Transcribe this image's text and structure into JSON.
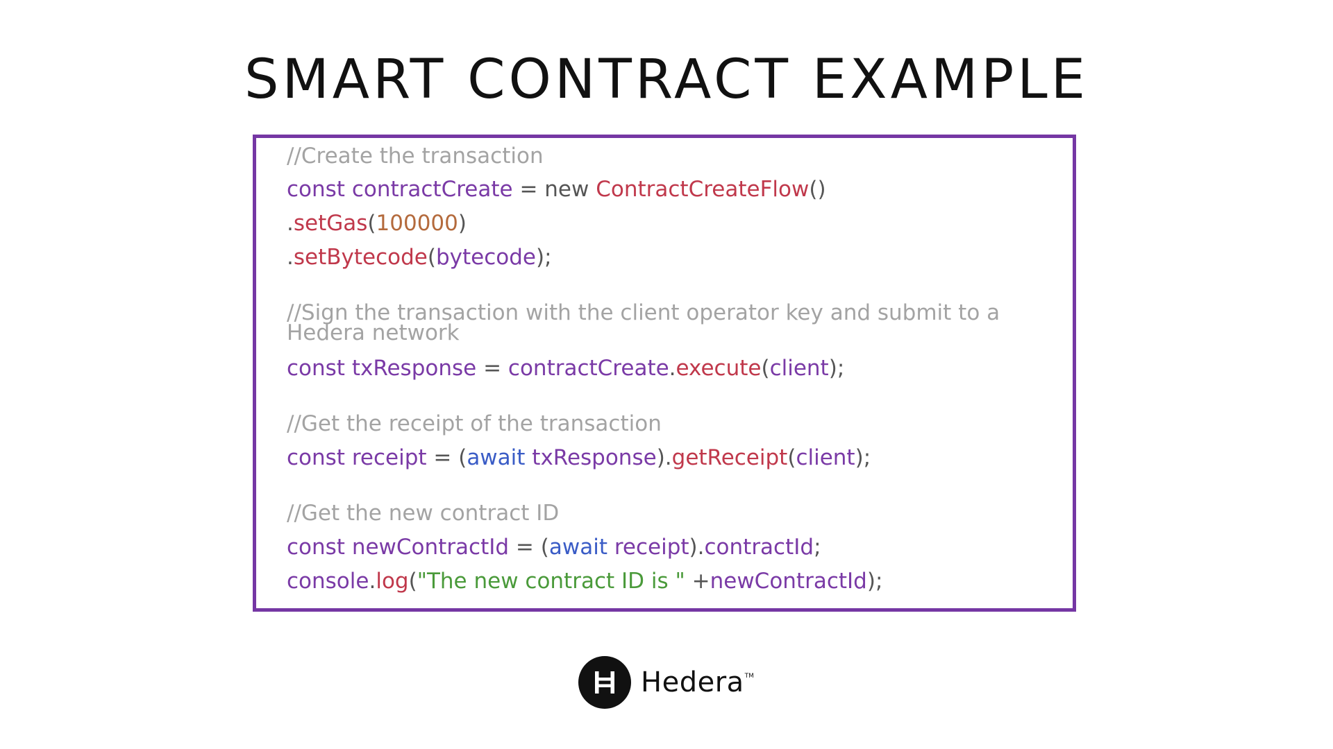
{
  "title": "SMART CONTRACT EXAMPLE",
  "colors": {
    "frame": "#7537a4",
    "comment": "#a3a3a3",
    "keyword": "#7a3aa6",
    "function": "#c0384b",
    "number": "#b46a3c",
    "await": "#3a5cc6",
    "string": "#4a9a3a"
  },
  "code": {
    "c1": "//Create the transaction",
    "l1": {
      "kw": "const",
      "var": "contractCreate",
      "eq": " = new ",
      "cls": "ContractCreateFlow",
      "tail": "()"
    },
    "l2": {
      "dot": ".",
      "fn": "setGas",
      "open": "(",
      "num": "100000",
      "close": ")"
    },
    "l3": {
      "dot": ".",
      "fn": "setBytecode",
      "open": "(",
      "arg": "bytecode",
      "close": ");"
    },
    "c2a": "//Sign the transaction with the client operator key and submit to a",
    "c2b": "Hedera network",
    "l4": {
      "kw": "const",
      "var": "txResponse",
      "eq": " = ",
      "obj": "contractCreate",
      "dot": ".",
      "fn": "execute",
      "open": "(",
      "arg": "client",
      "close": ");"
    },
    "c3": "//Get the receipt of the transaction",
    "l5": {
      "kw": "const",
      "var": "receipt",
      "eq": " = (",
      "await": "await",
      "obj": "txResponse",
      "paren": ").",
      "fn": "getReceipt",
      "open": "(",
      "arg": "client",
      "close": ");"
    },
    "c4": "//Get the new contract ID",
    "l6": {
      "kw": "const",
      "var": "newContractId",
      "eq": " = (",
      "await": "await",
      "obj": "receipt",
      "paren": ").",
      "prop": "contractId",
      "close": ";"
    },
    "l7": {
      "obj": "console",
      "dot": ".",
      "fn": "log",
      "open": "(",
      "str": "\"The new contract ID is \"",
      "plus": " +",
      "arg": "newContractId",
      "close": ");"
    }
  },
  "logo": {
    "icon": "hedera-h-icon",
    "name": "Hedera",
    "tm": "TM"
  }
}
